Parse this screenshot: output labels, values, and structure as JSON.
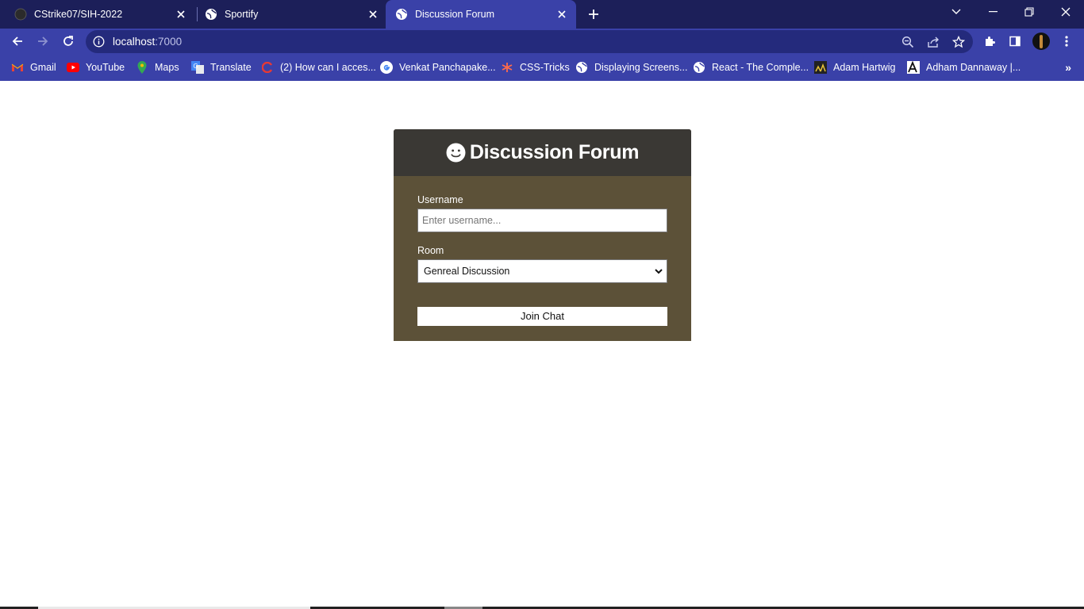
{
  "browser": {
    "tabs": [
      {
        "title": "CStrike07/SIH-2022",
        "icon": "github-icon"
      },
      {
        "title": "Sportify",
        "icon": "globe-icon"
      },
      {
        "title": "Discussion Forum",
        "icon": "globe-icon",
        "active": true
      }
    ],
    "url_host": "localhost",
    "url_port": ":7000",
    "bookmarks": [
      {
        "label": "Gmail",
        "icon": "gmail-icon"
      },
      {
        "label": "YouTube",
        "icon": "youtube-icon"
      },
      {
        "label": "Maps",
        "icon": "maps-icon"
      },
      {
        "label": "Translate",
        "icon": "translate-icon"
      },
      {
        "label": "(2) How can I acces...",
        "icon": "bookmark-icon"
      },
      {
        "label": "Venkat Panchapake...",
        "icon": "google-icon"
      },
      {
        "label": "CSS-Tricks",
        "icon": "css-tricks-icon"
      },
      {
        "label": "Displaying Screens...",
        "icon": "globe-icon"
      },
      {
        "label": "React - The Comple...",
        "icon": "globe-icon"
      },
      {
        "label": "Adam Hartwig",
        "icon": "bookmark-icon"
      },
      {
        "label": "Adham Dannaway |...",
        "icon": "bookmark-icon"
      }
    ]
  },
  "page": {
    "title": "Discussion Forum",
    "username_label": "Username",
    "username_placeholder": "Enter username...",
    "username_value": "",
    "room_label": "Room",
    "room_selected": "Genreal Discussion",
    "join_button": "Join Chat"
  },
  "colors": {
    "titlebar": "#1c1f59",
    "toolbar": "#3a41a8",
    "card_header": "#3a3834",
    "card_body": "#5c5138"
  }
}
